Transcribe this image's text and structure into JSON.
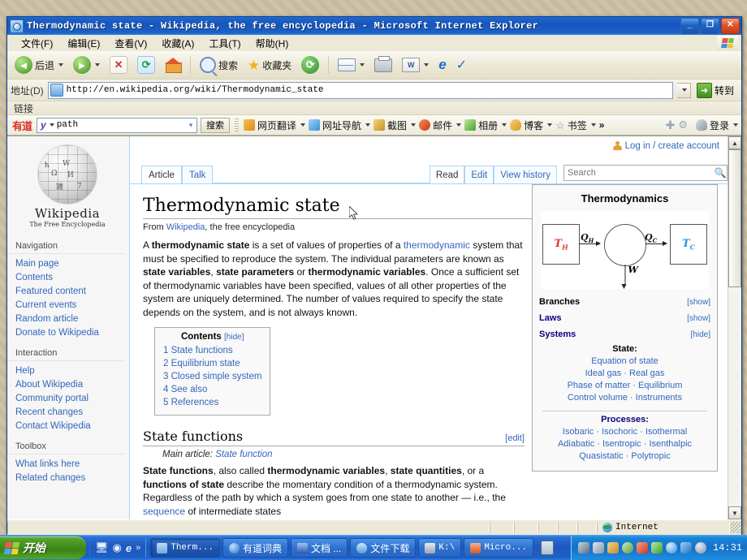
{
  "window": {
    "title": "Thermodynamic state - Wikipedia, the free encyclopedia - Microsoft Internet Explorer",
    "minimize_label": "_",
    "maximize_label": "❐",
    "close_label": "✕"
  },
  "menubar": [
    {
      "label": "文件(F)",
      "name": "menu-file"
    },
    {
      "label": "编辑(E)",
      "name": "menu-edit"
    },
    {
      "label": "查看(V)",
      "name": "menu-view"
    },
    {
      "label": "收藏(A)",
      "name": "menu-favorites"
    },
    {
      "label": "工具(T)",
      "name": "menu-tools"
    },
    {
      "label": "帮助(H)",
      "name": "menu-help"
    }
  ],
  "toolbar": {
    "back": "后退",
    "forward": "",
    "stop": "✕",
    "refresh": "⟳",
    "home": "",
    "search": "搜索",
    "favorites": "收藏夹",
    "history": "",
    "mail": "",
    "print": "",
    "word": "W",
    "ie": "e",
    "messenger": ""
  },
  "address": {
    "label": "地址(D)",
    "url": "http://en.wikipedia.org/wiki/Thermodynamic_state",
    "go_label": "转到",
    "caret": "▼"
  },
  "links_bar": {
    "label": "链接"
  },
  "youdao": {
    "logo": "有道",
    "y_mark": "y",
    "query": "path",
    "search_button": "搜索",
    "items": [
      {
        "label": "网页翻译",
        "color": "#f0a33c",
        "name": "youdao-webtranslate"
      },
      {
        "label": "网址导航",
        "color": "#5aa7e0",
        "name": "youdao-navigation"
      },
      {
        "label": "截图",
        "color": "#e0b24a",
        "name": "youdao-screenshot"
      },
      {
        "label": "邮件",
        "color": "#e05a2b",
        "name": "youdao-mail"
      },
      {
        "label": "相册",
        "color": "#6cc04a",
        "name": "youdao-album"
      },
      {
        "label": "博客",
        "color": "#e8a63c",
        "name": "youdao-blog"
      },
      {
        "label": "书签",
        "color": "#ffffff",
        "name": "youdao-bookmark"
      }
    ],
    "more": "»",
    "add_icon": "✚",
    "settings_icon": "⚙",
    "login": "登录"
  },
  "wiki": {
    "login_link": "Log in / create account",
    "tabs_left": [
      {
        "label": "Article",
        "active": true,
        "name": "tab-article"
      },
      {
        "label": "Talk",
        "active": false,
        "name": "tab-talk"
      }
    ],
    "tabs_right": [
      {
        "label": "Read",
        "active": true,
        "name": "tab-read"
      },
      {
        "label": "Edit",
        "active": false,
        "name": "tab-edit"
      },
      {
        "label": "View history",
        "active": false,
        "name": "tab-view-history"
      }
    ],
    "search_placeholder": "Search",
    "search_value": "",
    "logo": {
      "name": "Wikipedia",
      "tagline": "The Free Encyclopedia",
      "glyphs": [
        "W",
        "Ω",
        "И",
        "雑",
        "7",
        "ћ"
      ]
    },
    "sidebar": [
      {
        "heading": "Navigation",
        "name": "sidebar-section-navigation",
        "links": [
          "Main page",
          "Contents",
          "Featured content",
          "Current events",
          "Random article",
          "Donate to Wikipedia"
        ]
      },
      {
        "heading": "Interaction",
        "name": "sidebar-section-interaction",
        "links": [
          "Help",
          "About Wikipedia",
          "Community portal",
          "Recent changes",
          "Contact Wikipedia"
        ]
      },
      {
        "heading": "Toolbox",
        "name": "sidebar-section-toolbox",
        "links": [
          "What links here",
          "Related changes"
        ]
      }
    ],
    "article": {
      "title": "Thermodynamic state",
      "subtitle_prefix": "From ",
      "subtitle_link": "Wikipedia",
      "subtitle_suffix": ", the free encyclopedia",
      "lead": {
        "p1_a": "A ",
        "p1_b": "thermodynamic state",
        "p1_c": " is a set of values of properties of a ",
        "p1_link": "thermodynamic",
        "p1_d": " system that must be specified to reproduce the system. The individual parameters are known as ",
        "p1_e": "state variables",
        "p1_f": ", ",
        "p1_g": "state parameters",
        "p1_h": " or ",
        "p1_i": "thermodynamic variables",
        "p1_j": ". Once a sufficient set of thermodynamic variables have been specified, values of all other properties of the system are uniquely determined. The number of values required to specify the state depends on the system, and is not always known."
      },
      "toc": {
        "heading": "Contents",
        "hide": "[hide]",
        "items": [
          {
            "num": "1",
            "label": "State functions"
          },
          {
            "num": "2",
            "label": "Equilibrium state"
          },
          {
            "num": "3",
            "label": "Closed simple system"
          },
          {
            "num": "4",
            "label": "See also"
          },
          {
            "num": "5",
            "label": "References"
          }
        ]
      },
      "section1": {
        "heading": "State functions",
        "edit": "[edit]",
        "main_article_label": "Main article: ",
        "main_article_link": "State function",
        "p_a": "State functions",
        "p_b": ", also called ",
        "p_c": "thermodynamic variables",
        "p_d": ", ",
        "p_e": "state quantities",
        "p_f": ", or a ",
        "p_g": "functions of state",
        "p_h": " describe the momentary condition of a thermodynamic system. Regardless of the path by which a system goes from one state to another — i.e., the ",
        "p_link": "sequence",
        "p_i": " of intermediate states"
      }
    },
    "infobox": {
      "title": "Thermodynamics",
      "diagram": {
        "hot_label": "T",
        "hot_sub": "H",
        "cold_label": "T",
        "cold_sub": "C",
        "q_hot": "Q",
        "q_hot_sub": "H",
        "q_cold": "Q",
        "q_cold_sub": "C",
        "work": "W",
        "hot_color": "#e8372b",
        "cold_color": "#2196e8"
      },
      "rows": [
        {
          "key": "Branches",
          "value": "[show]",
          "name": "infobox-row-branches"
        },
        {
          "key": "Laws",
          "value": "[show]",
          "name": "infobox-row-laws"
        },
        {
          "key": "Systems",
          "value": "[hide]",
          "name": "infobox-row-systems"
        }
      ],
      "state_group": {
        "heading": "State",
        "heading_colon": ":",
        "lines": [
          "Equation of state",
          "Ideal gas · Real gas",
          "Phase of matter · Equilibrium",
          "Control volume · Instruments"
        ]
      },
      "processes_group": {
        "heading": "Processes",
        "heading_colon": ":",
        "lines": [
          "Isobaric · Isochoric · Isothermal",
          "Adiabatic · Isentropic · Isenthalpic",
          "Quasistatic · Polytropic"
        ]
      }
    }
  },
  "statusbar": {
    "zone": "Internet"
  },
  "taskbar": {
    "start": "开始",
    "quick_launch": [
      "desktop-icon",
      "media-icon",
      "ie-icon"
    ],
    "quick_more": "»",
    "tasks": [
      {
        "label": "Therm...",
        "active": true,
        "icon_color": "#8fc4f0",
        "name": "task-ie-thermodynamic",
        "cn": false
      },
      {
        "label": "有道词典",
        "active": false,
        "icon_color": "#3a8fd8",
        "name": "task-youdao-dict",
        "cn": true
      },
      {
        "label": "文档 ...",
        "active": false,
        "icon_color": "#3a6fd8",
        "name": "task-document",
        "cn": true
      },
      {
        "label": "文件下载",
        "active": false,
        "icon_color": "#7fb8ec",
        "name": "task-file-download",
        "cn": true
      },
      {
        "label": "K:\\",
        "active": false,
        "icon_color": "#b0b8c4",
        "name": "task-k-drive",
        "cn": false
      },
      {
        "label": "Micro...",
        "active": false,
        "icon_color": "#e06a3c",
        "name": "task-microsoft",
        "cn": false
      }
    ],
    "tray_icons": [
      "network-icon",
      "monitor-icon",
      "shield-icon",
      "app-icon",
      "volume-icon",
      "security-icon",
      "search-icon",
      "media-icon",
      "sync-icon"
    ],
    "clock": "14:31"
  }
}
